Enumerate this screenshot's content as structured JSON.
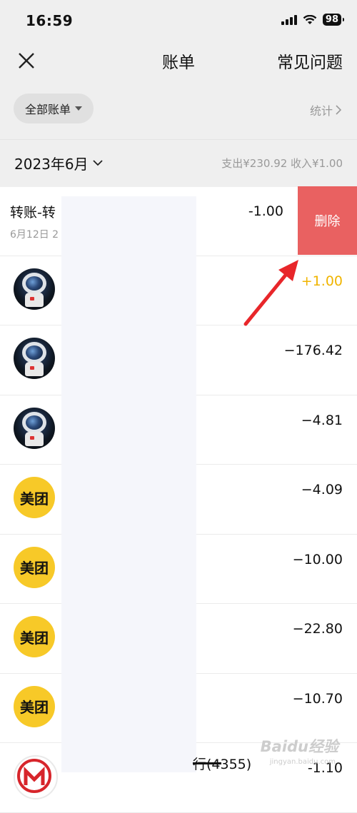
{
  "status_bar": {
    "time": "16:59",
    "battery": "98"
  },
  "nav": {
    "title": "账单",
    "faq": "常见问题"
  },
  "filter": {
    "label": "全部账单",
    "stats": "统计"
  },
  "month": {
    "label": "2023年6月",
    "summary": "支出¥230.92  收入¥1.00"
  },
  "first_row": {
    "title": "转账-转",
    "date": "6月12日 2",
    "amount": "-1.00",
    "delete_label": "删除"
  },
  "rows": [
    {
      "avatar": "astronaut",
      "amount": "+1.00"
    },
    {
      "avatar": "astronaut",
      "amount": "−176.42"
    },
    {
      "avatar": "astronaut",
      "amount": "−4.81"
    },
    {
      "avatar": "meituan",
      "logo_text": "美团",
      "amount": "−4.09"
    },
    {
      "avatar": "meituan",
      "logo_text": "美团",
      "amount": "−10.00"
    },
    {
      "avatar": "meituan",
      "logo_text": "美团",
      "amount": "−22.80"
    },
    {
      "avatar": "meituan",
      "logo_text": "美团",
      "amount": "−10.70"
    }
  ],
  "last_row": {
    "bank_text": "行(4355)",
    "amount": "-1.10"
  },
  "watermark": {
    "brand": "Baidu经验",
    "url": "jingyan.baidu.com"
  },
  "colors": {
    "delete_bg": "#e96161",
    "income": "#f0b400",
    "meituan": "#f7c928",
    "arrow": "#e8262a"
  }
}
